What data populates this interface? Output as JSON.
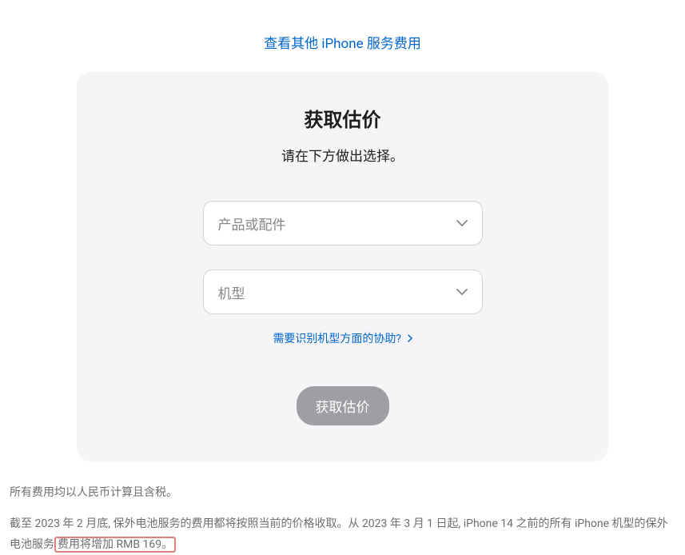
{
  "topLink": "查看其他 iPhone 服务费用",
  "card": {
    "title": "获取估价",
    "subtitle": "请在下方做出选择。",
    "select1": {
      "placeholder": "产品或配件"
    },
    "select2": {
      "placeholder": "机型"
    },
    "helpLink": "需要识别机型方面的协助?",
    "button": "获取估价"
  },
  "footer": {
    "line1": "所有费用均以人民币计算且含税。",
    "line2_part1": "截至 2023 年 2 月底, 保外电池服务的费用都将按照当前的价格收取。从 2023 年 3 月 1 日起, iPhone 14 之前的所有 iPhone 机型的保外电池服务",
    "line2_highlight": "费用将增加 RMB 169。"
  }
}
